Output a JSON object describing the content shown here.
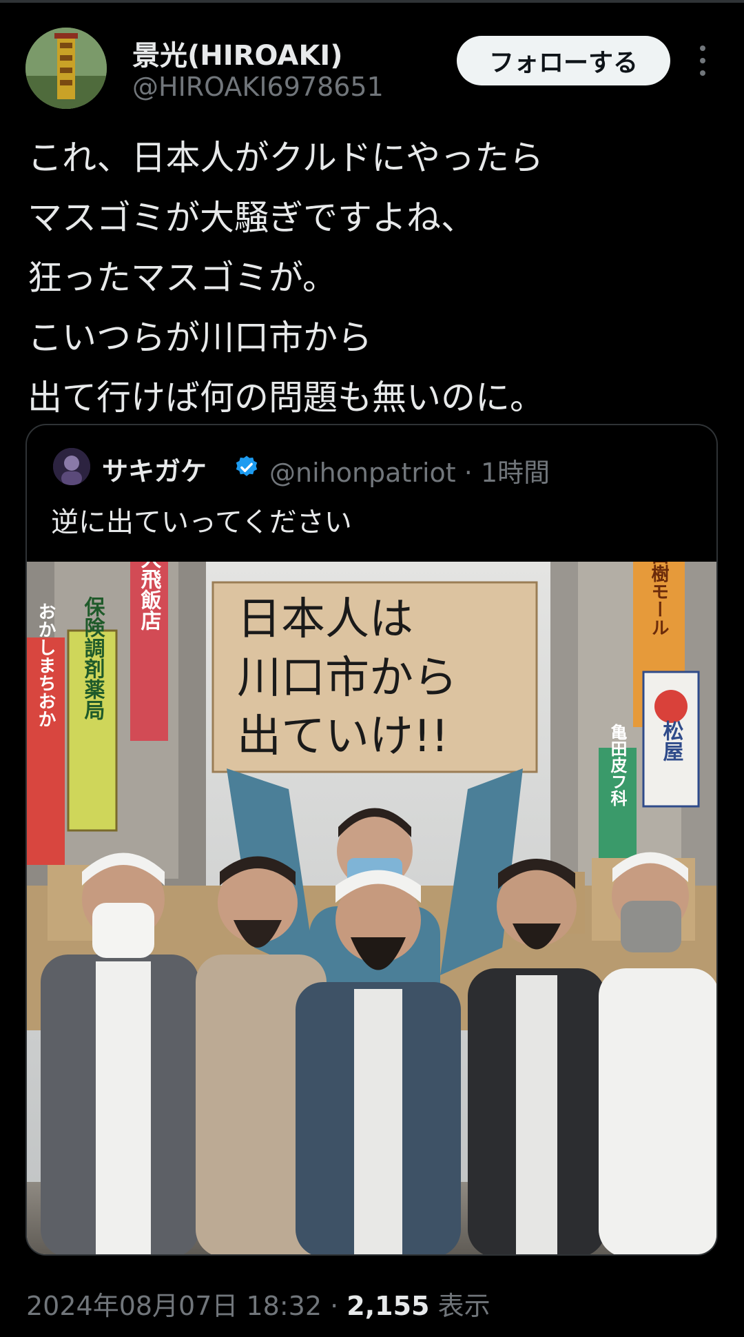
{
  "author": {
    "display_name": "景光(HIROAKI)",
    "handle": "@HIROAKI6978651",
    "avatar_icon": "tower-avatar-icon"
  },
  "follow_label": "フォローする",
  "more_icon": "more-vertical-icon",
  "post_lines": [
    "これ、日本人がクルドにやったら",
    "マスゴミが大騒ぎですよね、",
    "狂ったマスゴミが。",
    "こいつらが川口市から",
    "出て行けば何の問題も無いのに。"
  ],
  "quote": {
    "display_name": "サキガケ",
    "verified_icon": "verified-badge-icon",
    "handle": "@nihonpatriot",
    "separator": "·",
    "time_ago": "1時間",
    "text": "逆に出ていってください",
    "image": {
      "sign_lines": [
        "日本人は",
        "川口市から",
        "出ていけ!!"
      ],
      "shop_signs": [
        "保険調剤薬局",
        "おかしまちおか",
        "大飛飯店",
        "川口樹モール",
        "松屋",
        "亀田皮フ科"
      ]
    }
  },
  "footer": {
    "timestamp": "2024年08月07日 18:32",
    "separator": "·",
    "views_count": "2,155",
    "views_label": "表示"
  },
  "colors": {
    "background": "#000000",
    "text_primary": "#e7e9ea",
    "text_secondary": "#71767b",
    "border": "#2f3336",
    "follow_bg": "#eff3f4",
    "verified": "#1d9bf0"
  }
}
